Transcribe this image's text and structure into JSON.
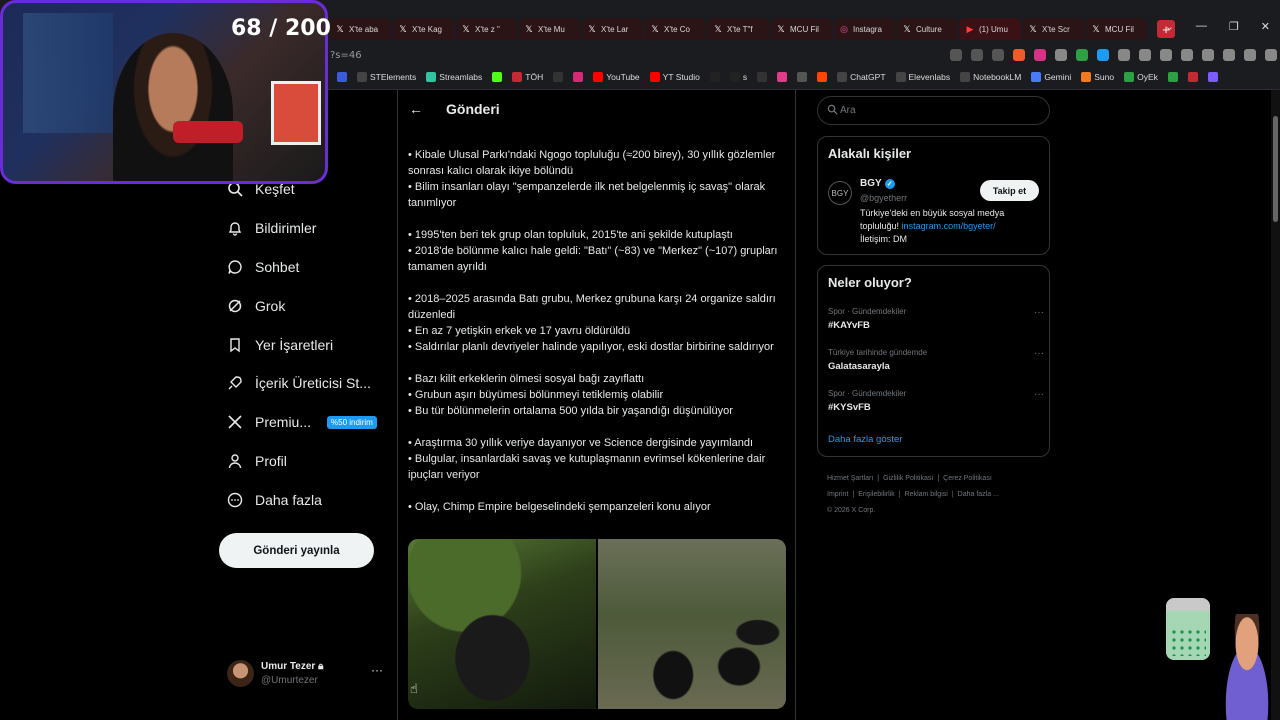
{
  "counter": "68 / 200",
  "browser": {
    "tabs": [
      {
        "label": "X'te aba",
        "icon": "x-icon"
      },
      {
        "label": "X'te Kag",
        "icon": "x-icon"
      },
      {
        "label": "X'te z \"",
        "icon": "x-icon"
      },
      {
        "label": "X'te Mu",
        "icon": "x-icon"
      },
      {
        "label": "X'te Lar",
        "icon": "x-icon"
      },
      {
        "label": "X'te Co",
        "icon": "x-icon"
      },
      {
        "label": "X'te T\"f",
        "icon": "x-icon"
      },
      {
        "label": "MCU Fil",
        "icon": "x-icon"
      },
      {
        "label": "Instagra",
        "icon": "instagram-icon"
      },
      {
        "label": "Culture",
        "icon": "x-icon"
      },
      {
        "label": "(1) Umu",
        "icon": "youtube-icon"
      },
      {
        "label": "X'te Scr",
        "icon": "x-icon"
      },
      {
        "label": "MCU Fil",
        "icon": "x-icon"
      }
    ],
    "new_tab": "+",
    "url": "?s=46",
    "bookmarks": [
      {
        "label": "",
        "icon": "r-icon",
        "color": "#3b5bdb"
      },
      {
        "label": "STElements",
        "icon": "steam-icon",
        "color": "#444"
      },
      {
        "label": "Streamlabs",
        "icon": "streamlabs-icon",
        "color": "#31c3a2"
      },
      {
        "label": "",
        "icon": "kick-icon",
        "color": "#53fc18"
      },
      {
        "label": "TÖH",
        "icon": "toh-icon",
        "color": "#c32a33"
      },
      {
        "label": "",
        "icon": "x-icon",
        "color": "#333"
      },
      {
        "label": "",
        "icon": "instagram-icon",
        "color": "#d62976"
      },
      {
        "label": "YouTube",
        "icon": "youtube-icon",
        "color": "#ff0000"
      },
      {
        "label": "YT Studio",
        "icon": "yt-studio-icon",
        "color": "#ff0000"
      },
      {
        "label": "",
        "icon": "tiktok-icon",
        "color": "#222"
      },
      {
        "label": "s",
        "icon": "tiktok-icon",
        "color": "#222"
      },
      {
        "label": "",
        "icon": "threads-icon",
        "color": "#333"
      },
      {
        "label": "",
        "icon": "bookmark-icon",
        "color": "#e03c8a"
      },
      {
        "label": "",
        "icon": "docs-icon",
        "color": "#555"
      },
      {
        "label": "",
        "icon": "reddit-icon",
        "color": "#ff4500"
      },
      {
        "label": "ChatGPT",
        "icon": "chatgpt-icon",
        "color": "#444"
      },
      {
        "label": "Elevenlabs",
        "icon": "elevenlabs-icon",
        "color": "#444"
      },
      {
        "label": "NotebookLM",
        "icon": "notebooklm-icon",
        "color": "#444"
      },
      {
        "label": "Gemini",
        "icon": "gemini-icon",
        "color": "#4a7bf7"
      },
      {
        "label": "Suno",
        "icon": "suno-icon",
        "color": "#f07b22"
      },
      {
        "label": "OyEk",
        "icon": "oyek-icon",
        "color": "#2ea043"
      },
      {
        "label": "",
        "icon": "green-icon",
        "color": "#2ea043"
      },
      {
        "label": "",
        "icon": "pdf-icon",
        "color": "#c32a33"
      },
      {
        "label": "",
        "icon": "app-icon",
        "color": "#7c5cff"
      }
    ]
  },
  "nav": {
    "items": [
      {
        "label": "Keşfet",
        "icon": "search-icon"
      },
      {
        "label": "Bildirimler",
        "icon": "bell-icon"
      },
      {
        "label": "Sohbet",
        "icon": "chat-icon"
      },
      {
        "label": "Grok",
        "icon": "grok-icon"
      },
      {
        "label": "Yer İşaretleri",
        "icon": "bookmark-icon"
      },
      {
        "label": "İçerik Üreticisi St...",
        "icon": "rocket-icon"
      },
      {
        "label": "Premiu...",
        "icon": "x-icon",
        "badge": "%50 indirim"
      },
      {
        "label": "Profil",
        "icon": "person-icon"
      },
      {
        "label": "Daha fazla",
        "icon": "more-circle-icon"
      }
    ],
    "post_button": "Gönderi yayınla",
    "account": {
      "name": "Umur Tezer",
      "handle": "@Umurtezer"
    }
  },
  "main": {
    "title": "Gönderi",
    "paragraphs": [
      [
        "• Kibale Ulusal Parkı'ndaki Ngogo topluluğu (≈200 birey), 30 yıllık gözlemler sonrası kalıcı olarak ikiye bölündü",
        "• Bilim insanları olayı \"şempanzelerde ilk net belgelenmiş iç savaş\" olarak tanımlıyor"
      ],
      [
        "• 1995'ten beri tek grup olan topluluk, 2015'te ani şekilde kutuplaştı",
        "• 2018'de bölünme kalıcı hale geldi: \"Batı\" (~83) ve \"Merkez\" (~107) grupları tamamen ayrıldı"
      ],
      [
        "• 2018–2025 arasında Batı grubu, Merkez grubuna karşı 24 organize saldırı düzenledi",
        "• En az 7 yetişkin erkek ve 17 yavru öldürüldü",
        "• Saldırılar planlı devriyeler halinde yapılıyor, eski dostlar birbirine saldırıyor"
      ],
      [
        "• Bazı kilit erkeklerin ölmesi sosyal bağı zayıflattı",
        "• Grubun aşırı büyümesi bölünmeyi tetiklemiş olabilir",
        "• Bu tür bölünmelerin ortalama 500 yılda bir yaşandığı düşünülüyor"
      ],
      [
        "• Araştırma 30 yıllık veriye dayanıyor ve Science dergisinde yayımlandı",
        "• Bulgular, insanlardaki savaş ve kutuplaşmanın evrimsel kökenlerine dair ipuçları veriyor"
      ],
      [
        "• Olay, Chimp Empire belgeselindeki şempanzeleri konu alıyor"
      ]
    ]
  },
  "right": {
    "search_placeholder": "Ara",
    "related": {
      "title": "Alakalı kişiler",
      "logo_text": "BGY",
      "name": "BGY",
      "handle": "@bgyetherr",
      "follow": "Takip et",
      "bio_text": "Türkiye'deki en büyük sosyal medya topluluğu!",
      "bio_link": "instagram.com/bgyeter/",
      "bio_contact": "İletişim: DM"
    },
    "trends": {
      "title": "Neler oluyor?",
      "items": [
        {
          "meta": "Spor · Gündemdekiler",
          "tag": "#KAYvFB"
        },
        {
          "meta": "Türkiye tarihinde gündemde",
          "tag": "Galatasarayla"
        },
        {
          "meta": "Spor · Gündemdekiler",
          "tag": "#KYSvFB"
        }
      ],
      "show_more": "Daha fazla göster"
    },
    "footer": [
      "Hizmet Şartları",
      "Gizlilik Politikası",
      "Çerez Politikası",
      "Imprint",
      "Erişilebilirlik",
      "Reklam bilgisi",
      "Daha fazla ...",
      "© 2026 X Corp."
    ]
  },
  "colors": {
    "accent": "#1d9bf0",
    "cam_border": "#6a2bd9",
    "tab_active_red": "#c32a33"
  }
}
